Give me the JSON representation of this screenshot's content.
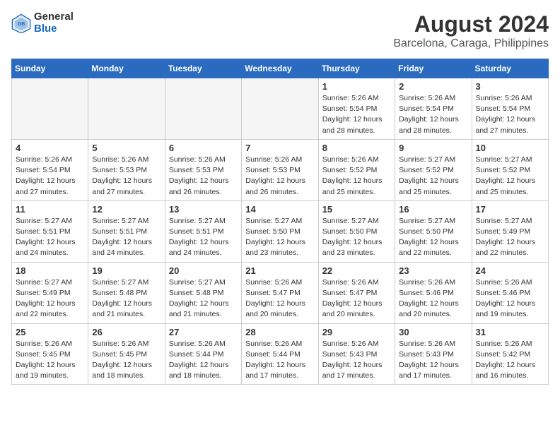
{
  "header": {
    "logo_general": "General",
    "logo_blue": "Blue",
    "title": "August 2024",
    "subtitle": "Barcelona, Caraga, Philippines"
  },
  "days_of_week": [
    "Sunday",
    "Monday",
    "Tuesday",
    "Wednesday",
    "Thursday",
    "Friday",
    "Saturday"
  ],
  "weeks": [
    [
      {
        "day": "",
        "info": ""
      },
      {
        "day": "",
        "info": ""
      },
      {
        "day": "",
        "info": ""
      },
      {
        "day": "",
        "info": ""
      },
      {
        "day": "1",
        "info": "Sunrise: 5:26 AM\nSunset: 5:54 PM\nDaylight: 12 hours\nand 28 minutes."
      },
      {
        "day": "2",
        "info": "Sunrise: 5:26 AM\nSunset: 5:54 PM\nDaylight: 12 hours\nand 28 minutes."
      },
      {
        "day": "3",
        "info": "Sunrise: 5:26 AM\nSunset: 5:54 PM\nDaylight: 12 hours\nand 27 minutes."
      }
    ],
    [
      {
        "day": "4",
        "info": "Sunrise: 5:26 AM\nSunset: 5:54 PM\nDaylight: 12 hours\nand 27 minutes."
      },
      {
        "day": "5",
        "info": "Sunrise: 5:26 AM\nSunset: 5:53 PM\nDaylight: 12 hours\nand 27 minutes."
      },
      {
        "day": "6",
        "info": "Sunrise: 5:26 AM\nSunset: 5:53 PM\nDaylight: 12 hours\nand 26 minutes."
      },
      {
        "day": "7",
        "info": "Sunrise: 5:26 AM\nSunset: 5:53 PM\nDaylight: 12 hours\nand 26 minutes."
      },
      {
        "day": "8",
        "info": "Sunrise: 5:26 AM\nSunset: 5:52 PM\nDaylight: 12 hours\nand 25 minutes."
      },
      {
        "day": "9",
        "info": "Sunrise: 5:27 AM\nSunset: 5:52 PM\nDaylight: 12 hours\nand 25 minutes."
      },
      {
        "day": "10",
        "info": "Sunrise: 5:27 AM\nSunset: 5:52 PM\nDaylight: 12 hours\nand 25 minutes."
      }
    ],
    [
      {
        "day": "11",
        "info": "Sunrise: 5:27 AM\nSunset: 5:51 PM\nDaylight: 12 hours\nand 24 minutes."
      },
      {
        "day": "12",
        "info": "Sunrise: 5:27 AM\nSunset: 5:51 PM\nDaylight: 12 hours\nand 24 minutes."
      },
      {
        "day": "13",
        "info": "Sunrise: 5:27 AM\nSunset: 5:51 PM\nDaylight: 12 hours\nand 24 minutes."
      },
      {
        "day": "14",
        "info": "Sunrise: 5:27 AM\nSunset: 5:50 PM\nDaylight: 12 hours\nand 23 minutes."
      },
      {
        "day": "15",
        "info": "Sunrise: 5:27 AM\nSunset: 5:50 PM\nDaylight: 12 hours\nand 23 minutes."
      },
      {
        "day": "16",
        "info": "Sunrise: 5:27 AM\nSunset: 5:50 PM\nDaylight: 12 hours\nand 22 minutes."
      },
      {
        "day": "17",
        "info": "Sunrise: 5:27 AM\nSunset: 5:49 PM\nDaylight: 12 hours\nand 22 minutes."
      }
    ],
    [
      {
        "day": "18",
        "info": "Sunrise: 5:27 AM\nSunset: 5:49 PM\nDaylight: 12 hours\nand 22 minutes."
      },
      {
        "day": "19",
        "info": "Sunrise: 5:27 AM\nSunset: 5:48 PM\nDaylight: 12 hours\nand 21 minutes."
      },
      {
        "day": "20",
        "info": "Sunrise: 5:27 AM\nSunset: 5:48 PM\nDaylight: 12 hours\nand 21 minutes."
      },
      {
        "day": "21",
        "info": "Sunrise: 5:26 AM\nSunset: 5:47 PM\nDaylight: 12 hours\nand 20 minutes."
      },
      {
        "day": "22",
        "info": "Sunrise: 5:26 AM\nSunset: 5:47 PM\nDaylight: 12 hours\nand 20 minutes."
      },
      {
        "day": "23",
        "info": "Sunrise: 5:26 AM\nSunset: 5:46 PM\nDaylight: 12 hours\nand 20 minutes."
      },
      {
        "day": "24",
        "info": "Sunrise: 5:26 AM\nSunset: 5:46 PM\nDaylight: 12 hours\nand 19 minutes."
      }
    ],
    [
      {
        "day": "25",
        "info": "Sunrise: 5:26 AM\nSunset: 5:45 PM\nDaylight: 12 hours\nand 19 minutes."
      },
      {
        "day": "26",
        "info": "Sunrise: 5:26 AM\nSunset: 5:45 PM\nDaylight: 12 hours\nand 18 minutes."
      },
      {
        "day": "27",
        "info": "Sunrise: 5:26 AM\nSunset: 5:44 PM\nDaylight: 12 hours\nand 18 minutes."
      },
      {
        "day": "28",
        "info": "Sunrise: 5:26 AM\nSunset: 5:44 PM\nDaylight: 12 hours\nand 17 minutes."
      },
      {
        "day": "29",
        "info": "Sunrise: 5:26 AM\nSunset: 5:43 PM\nDaylight: 12 hours\nand 17 minutes."
      },
      {
        "day": "30",
        "info": "Sunrise: 5:26 AM\nSunset: 5:43 PM\nDaylight: 12 hours\nand 17 minutes."
      },
      {
        "day": "31",
        "info": "Sunrise: 5:26 AM\nSunset: 5:42 PM\nDaylight: 12 hours\nand 16 minutes."
      }
    ]
  ]
}
